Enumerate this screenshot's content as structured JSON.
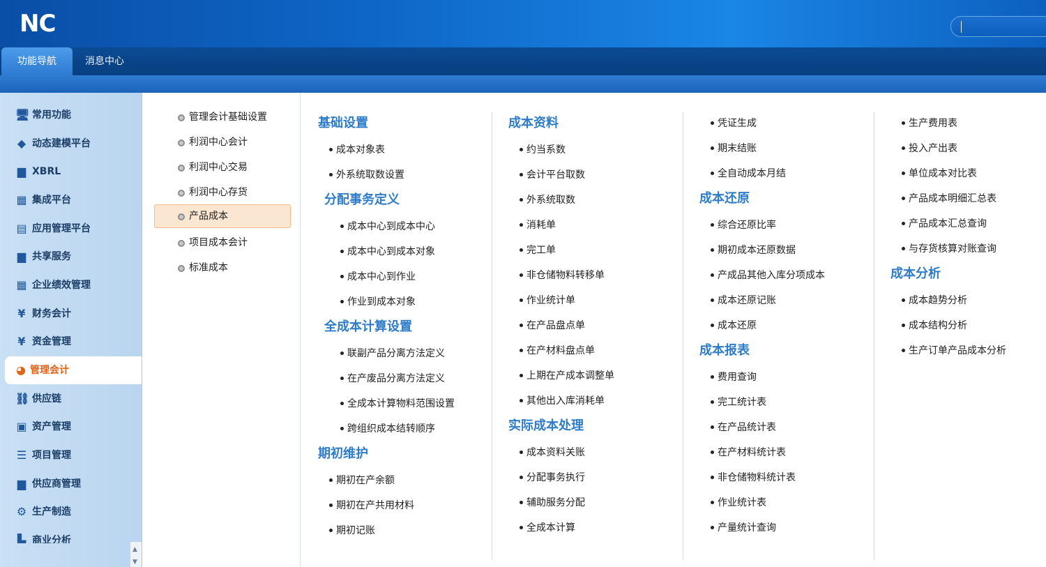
{
  "header": {
    "logo": "NC",
    "search_value": ""
  },
  "tabs": [
    {
      "label": "功能导航",
      "active": true
    },
    {
      "label": "消息中心",
      "active": false
    }
  ],
  "sidebar": {
    "items": [
      {
        "label": "常用功能",
        "icon": "monitor-icon"
      },
      {
        "label": "动态建模平台",
        "icon": "cube-icon"
      },
      {
        "label": "XBRL",
        "icon": "folder-icon"
      },
      {
        "label": "集成平台",
        "icon": "grid-icon"
      },
      {
        "label": "应用管理平台",
        "icon": "panel-icon"
      },
      {
        "label": "共享服务",
        "icon": "folder-icon"
      },
      {
        "label": "企业绩效管理",
        "icon": "table-icon"
      },
      {
        "label": "财务会计",
        "icon": "yen-box-icon"
      },
      {
        "label": "资金管理",
        "icon": "yen-icon"
      },
      {
        "label": "管理会计",
        "icon": "gauge-icon",
        "active": true
      },
      {
        "label": "供应链",
        "icon": "link-icon"
      },
      {
        "label": "资产管理",
        "icon": "assets-icon"
      },
      {
        "label": "项目管理",
        "icon": "list-icon"
      },
      {
        "label": "供应商管理",
        "icon": "folder-icon"
      },
      {
        "label": "生产制造",
        "icon": "gear-icon"
      },
      {
        "label": "商业分析",
        "icon": "chart-icon"
      }
    ]
  },
  "submenu": {
    "items": [
      {
        "label": "管理会计基础设置"
      },
      {
        "label": "利润中心会计"
      },
      {
        "label": "利润中心交易"
      },
      {
        "label": "利润中心存货"
      },
      {
        "label": "产品成本",
        "active": true
      },
      {
        "label": "项目成本会计"
      },
      {
        "label": "标准成本"
      }
    ]
  },
  "columns": [
    {
      "sections": [
        {
          "title": "基础设置",
          "items": [
            "成本对象表",
            "外系统取数设置"
          ]
        },
        {
          "title": "分配事务定义",
          "items": [
            "成本中心到成本中心",
            "成本中心到成本对象",
            "成本中心到作业",
            "作业到成本对象"
          ]
        },
        {
          "title": "全成本计算设置",
          "items": [
            "联副产品分离方法定义",
            "在产废品分离方法定义",
            "全成本计算物料范围设置",
            "跨组织成本结转顺序"
          ]
        },
        {
          "title": "期初维护",
          "items": [
            "期初在产余额",
            "期初在产共用材料",
            "期初记账"
          ]
        }
      ]
    },
    {
      "sections": [
        {
          "title": "成本资料",
          "items": [
            "约当系数",
            "会计平台取数",
            "外系统取数",
            "消耗单",
            "完工单",
            "非仓储物料转移单",
            "作业统计单",
            "在产品盘点单",
            "在产材料盘点单",
            "上期在产成本调整单",
            "其他出入库消耗单"
          ]
        },
        {
          "title": "实际成本处理",
          "items": [
            "成本资料关账",
            "分配事务执行",
            "辅助服务分配",
            "全成本计算"
          ]
        }
      ]
    },
    {
      "sections": [
        {
          "title": "",
          "items": [
            "凭证生成",
            "期末结账",
            "全自动成本月结"
          ]
        },
        {
          "title": "成本还原",
          "items": [
            "综合还原比率",
            "期初成本还原数据",
            "产成品其他入库分项成本",
            "成本还原记账",
            "成本还原"
          ]
        },
        {
          "title": "成本报表",
          "items": [
            "费用查询",
            "完工统计表",
            "在产品统计表",
            "在产材料统计表",
            "非仓储物料统计表",
            "作业统计表",
            "产量统计查询"
          ]
        }
      ]
    },
    {
      "sections": [
        {
          "title": "",
          "items": [
            "生产费用表",
            "投入产出表",
            "单位成本对比表",
            "产品成本明细汇总表",
            "产品成本汇总查询",
            "与存货核算对账查询"
          ]
        },
        {
          "title": "成本分析",
          "items": [
            "成本趋势分析",
            "成本结构分析",
            "生产订单产品成本分析"
          ]
        }
      ]
    }
  ],
  "colors": {
    "header_blue": "#0e66c6",
    "section_title": "#2f7cc8",
    "active_orange": "#e0631a"
  }
}
